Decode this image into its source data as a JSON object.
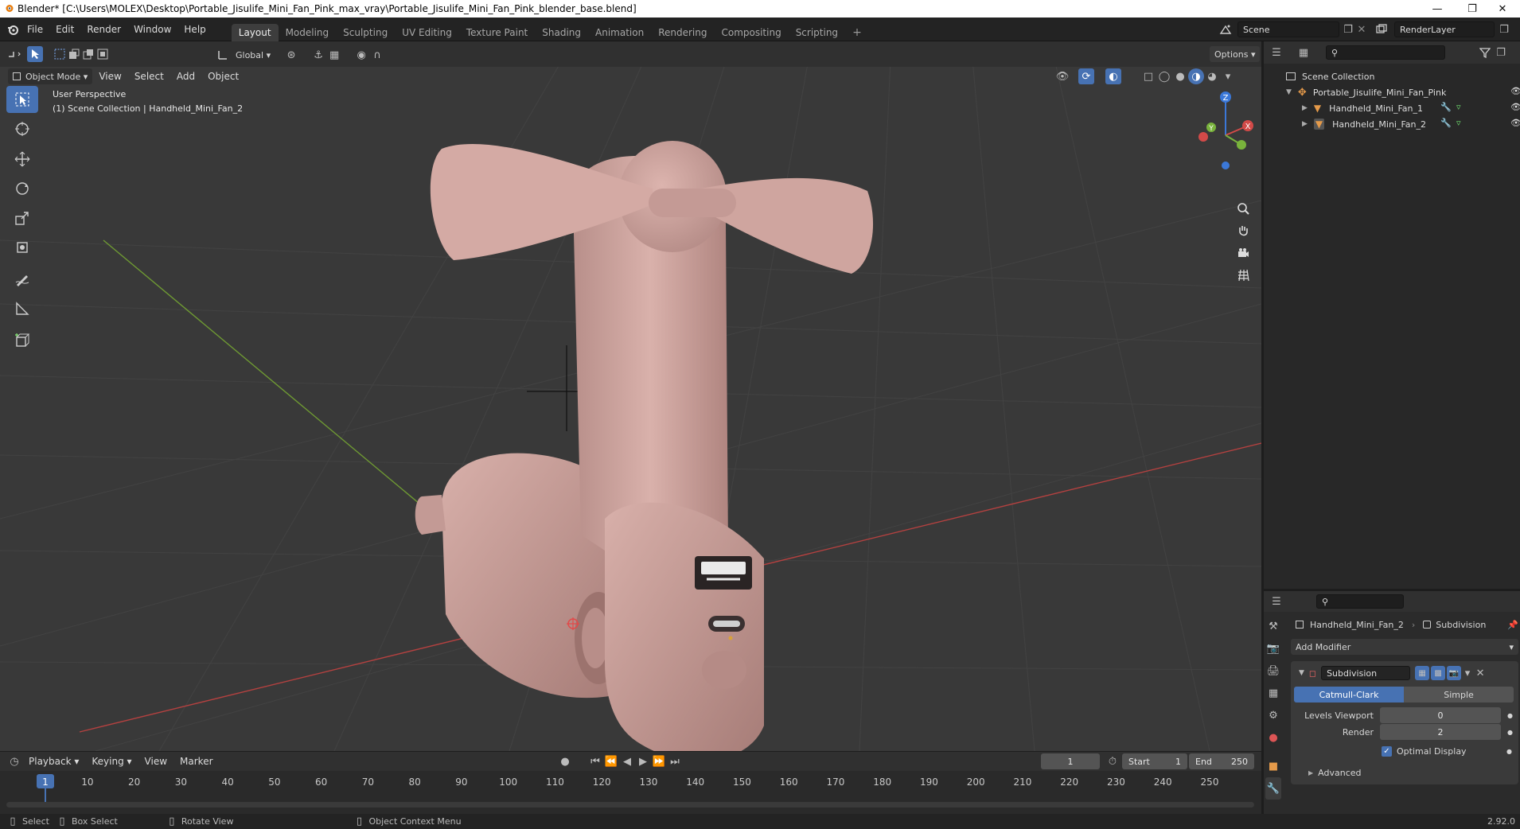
{
  "titlebar": {
    "text": "Blender* [C:\\Users\\MOLEX\\Desktop\\Portable_Jisulife_Mini_Fan_Pink_max_vray\\Portable_Jisulife_Mini_Fan_Pink_blender_base.blend]"
  },
  "menus": [
    "File",
    "Edit",
    "Render",
    "Window",
    "Help"
  ],
  "workspaces": [
    "Layout",
    "Modeling",
    "Sculpting",
    "UV Editing",
    "Texture Paint",
    "Shading",
    "Animation",
    "Rendering",
    "Compositing",
    "Scripting"
  ],
  "scene": {
    "name": "Scene",
    "render_layer": "RenderLayer"
  },
  "viewport_header": {
    "mode": "Object Mode",
    "menus": [
      "View",
      "Select",
      "Add",
      "Object"
    ],
    "orientation": "Global",
    "options": "Options"
  },
  "viewport": {
    "perspective": "User Perspective",
    "collection": "(1) Scene Collection | Handheld_Mini_Fan_2",
    "gizmo": {
      "x": "X",
      "y": "Y",
      "z": "Z"
    }
  },
  "outliner": {
    "root": "Scene Collection",
    "items": [
      {
        "label": "Portable_Jisulife_Mini_Fan_Pink",
        "depth": 1
      },
      {
        "label": "Handheld_Mini_Fan_1",
        "depth": 2
      },
      {
        "label": "Handheld_Mini_Fan_2",
        "depth": 2
      }
    ]
  },
  "properties": {
    "object": "Handheld_Mini_Fan_2",
    "modifier_crumb": "Subdivision",
    "add_modifier": "Add Modifier",
    "modifier_name": "Subdivision",
    "mode_a": "Catmull-Clark",
    "mode_b": "Simple",
    "levels_label": "Levels Viewport",
    "levels_value": "0",
    "render_label": "Render",
    "render_value": "2",
    "optimal_label": "Optimal Display",
    "advanced": "Advanced"
  },
  "timeline": {
    "menus": [
      "Playback",
      "Keying",
      "View",
      "Marker"
    ],
    "current_frame": "1",
    "start_label": "Start",
    "start": "1",
    "end_label": "End",
    "end": "250",
    "ticks": [
      "1",
      "10",
      "20",
      "30",
      "40",
      "50",
      "60",
      "70",
      "80",
      "90",
      "100",
      "110",
      "120",
      "130",
      "140",
      "150",
      "160",
      "170",
      "180",
      "190",
      "200",
      "210",
      "220",
      "230",
      "240",
      "250"
    ]
  },
  "status": {
    "select": "Select",
    "box_select": "Box Select",
    "rotate": "Rotate View",
    "context": "Object Context Menu",
    "version": "2.92.0"
  },
  "colors": {
    "accent": "#4772b3",
    "model": "#c9a09b",
    "x_axis": "#c8413f",
    "y_axis": "#7fae3a"
  }
}
